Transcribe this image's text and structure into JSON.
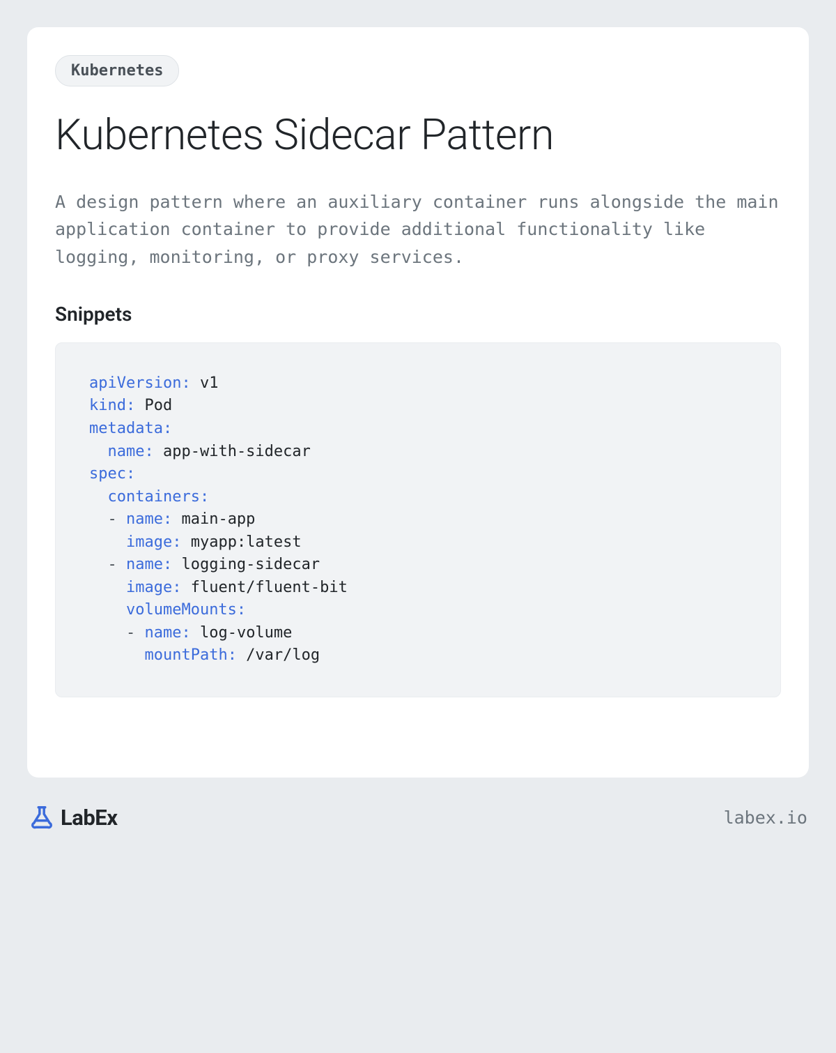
{
  "tag": "Kubernetes",
  "title": "Kubernetes Sidecar Pattern",
  "description": "A design pattern where an auxiliary container runs alongside the main application container to provide additional functionality like logging, monitoring, or proxy services.",
  "section_heading": "Snippets",
  "code": {
    "lines": [
      {
        "indent": 0,
        "dash": false,
        "key": "apiVersion:",
        "val": " v1"
      },
      {
        "indent": 0,
        "dash": false,
        "key": "kind:",
        "val": " Pod"
      },
      {
        "indent": 0,
        "dash": false,
        "key": "metadata:",
        "val": ""
      },
      {
        "indent": 1,
        "dash": false,
        "key": "name:",
        "val": " app-with-sidecar"
      },
      {
        "indent": 0,
        "dash": false,
        "key": "spec:",
        "val": ""
      },
      {
        "indent": 1,
        "dash": false,
        "key": "containers:",
        "val": ""
      },
      {
        "indent": 1,
        "dash": true,
        "key": "name:",
        "val": " main-app"
      },
      {
        "indent": 2,
        "dash": false,
        "key": "image:",
        "val": " myapp:latest"
      },
      {
        "indent": 1,
        "dash": true,
        "key": "name:",
        "val": " logging-sidecar"
      },
      {
        "indent": 2,
        "dash": false,
        "key": "image:",
        "val": " fluent/fluent-bit"
      },
      {
        "indent": 2,
        "dash": false,
        "key": "volumeMounts:",
        "val": ""
      },
      {
        "indent": 2,
        "dash": true,
        "key": "name:",
        "val": " log-volume"
      },
      {
        "indent": 3,
        "dash": false,
        "key": "mountPath:",
        "val": " /var/log"
      }
    ]
  },
  "brand": {
    "name": "LabEx",
    "url": "labex.io"
  }
}
